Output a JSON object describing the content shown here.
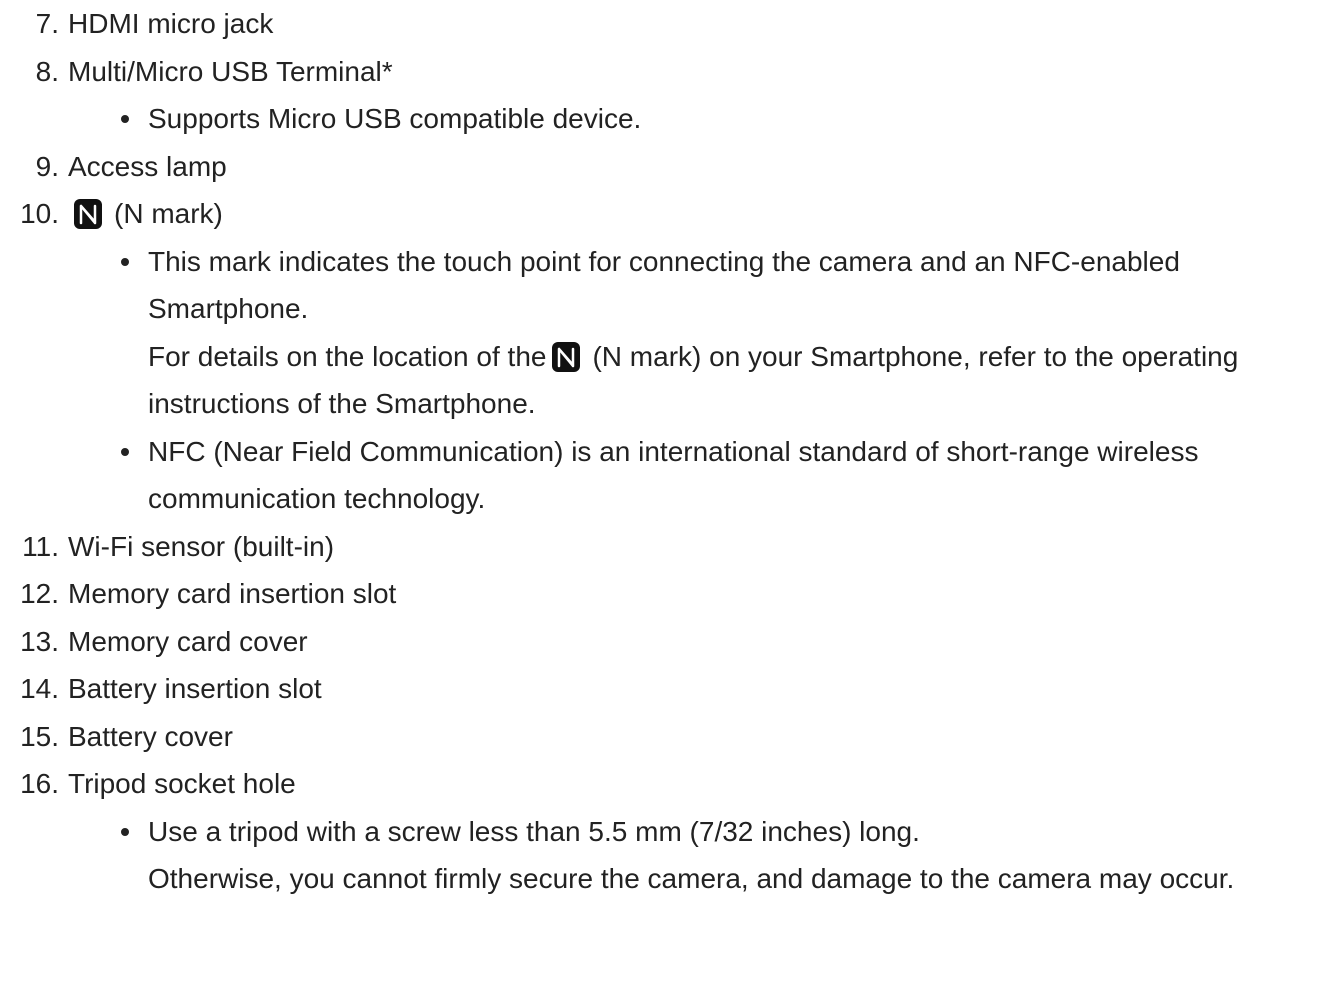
{
  "items": [
    {
      "num": "7.",
      "text": "HDMI micro jack"
    },
    {
      "num": "8.",
      "text": "Multi/Micro USB Terminal*"
    },
    {
      "num": "9.",
      "text": "Access lamp"
    },
    {
      "num": "10.",
      "text": "(N mark)"
    },
    {
      "num": "11.",
      "text": "Wi-Fi sensor (built-in)"
    },
    {
      "num": "12.",
      "text": "Memory card insertion slot"
    },
    {
      "num": "13.",
      "text": "Memory card cover"
    },
    {
      "num": "14.",
      "text": "Battery insertion slot"
    },
    {
      "num": "15.",
      "text": "Battery cover"
    },
    {
      "num": "16.",
      "text": "Tripod socket hole"
    }
  ],
  "notes": {
    "usb": "Supports Micro USB compatible device.",
    "nfc_1": "This mark indicates the touch point for connecting the camera and an NFC-enabled Smartphone.",
    "nfc_2a": "For details on the location of the",
    "nfc_2b": "(N mark) on your Smartphone, refer to the operating instructions of the Smartphone.",
    "nfc_3": "NFC (Near Field Communication) is an international standard of short-range wireless communication technology.",
    "tripod_1": "Use a tripod with a screw less than 5.5 mm (7/32 inches) long.",
    "tripod_2": "Otherwise, you cannot firmly secure the camera, and damage to the camera may occur."
  },
  "icons": {
    "n_mark": "nfc-n-mark-icon"
  },
  "colors": {
    "text": "#222222",
    "icon": "#111111"
  }
}
